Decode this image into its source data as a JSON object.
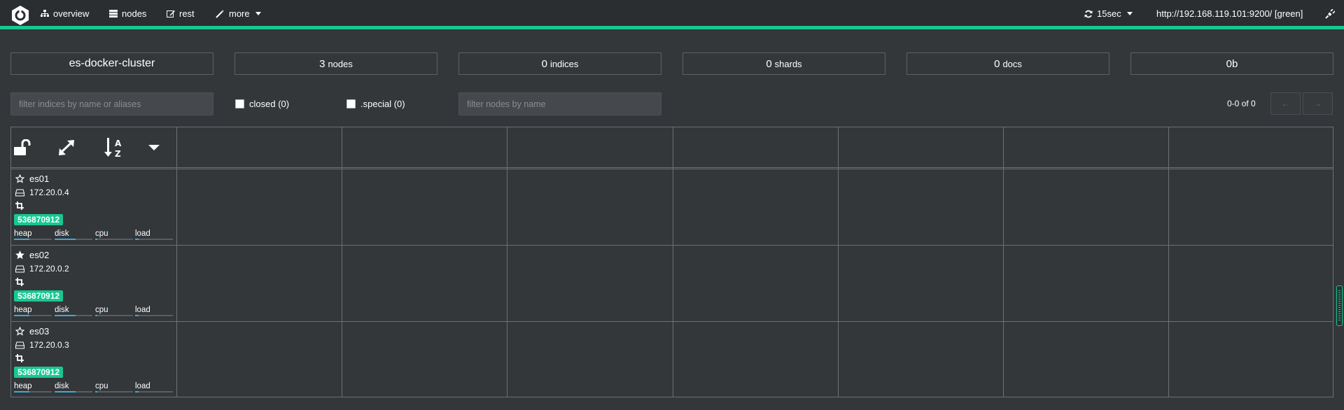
{
  "nav": {
    "overview": "overview",
    "nodes": "nodes",
    "rest": "rest",
    "more": "more",
    "refresh": "15sec",
    "cluster_url": "http://192.168.119.101:9200/ [green]"
  },
  "stats": {
    "cluster_name": "es-docker-cluster",
    "nodes_count": "3",
    "nodes_label": "nodes",
    "indices_count": "0",
    "indices_label": "indices",
    "shards_count": "0",
    "shards_label": "shards",
    "docs_count": "0",
    "docs_label": "docs",
    "size": "0b"
  },
  "filters": {
    "indices_placeholder": "filter indices by name or aliases",
    "closed_label": "closed (0)",
    "special_label": ".special (0)",
    "nodes_placeholder": "filter nodes by name",
    "pager": "0-0 of 0",
    "prev": "←",
    "next": "→"
  },
  "nodes": [
    {
      "name": "es01",
      "ip": "172.20.0.4",
      "heap_max": "536870912",
      "master": false,
      "metrics": {
        "heap": 0.4,
        "disk": 0.55,
        "cpu": 0.05,
        "load": 0.1
      }
    },
    {
      "name": "es02",
      "ip": "172.20.0.2",
      "heap_max": "536870912",
      "master": true,
      "metrics": {
        "heap": 0.4,
        "disk": 0.55,
        "cpu": 0.05,
        "load": 0.1
      }
    },
    {
      "name": "es03",
      "ip": "172.20.0.3",
      "heap_max": "536870912",
      "master": false,
      "metrics": {
        "heap": 0.4,
        "disk": 0.55,
        "cpu": 0.05,
        "load": 0.1
      }
    }
  ],
  "metric_labels": {
    "heap": "heap",
    "disk": "disk",
    "cpu": "cpu",
    "load": "load"
  },
  "colors": {
    "accent": "#18c791",
    "bar": "#3fa9d8",
    "background": "#33373a",
    "navbar": "#2b2e31"
  }
}
